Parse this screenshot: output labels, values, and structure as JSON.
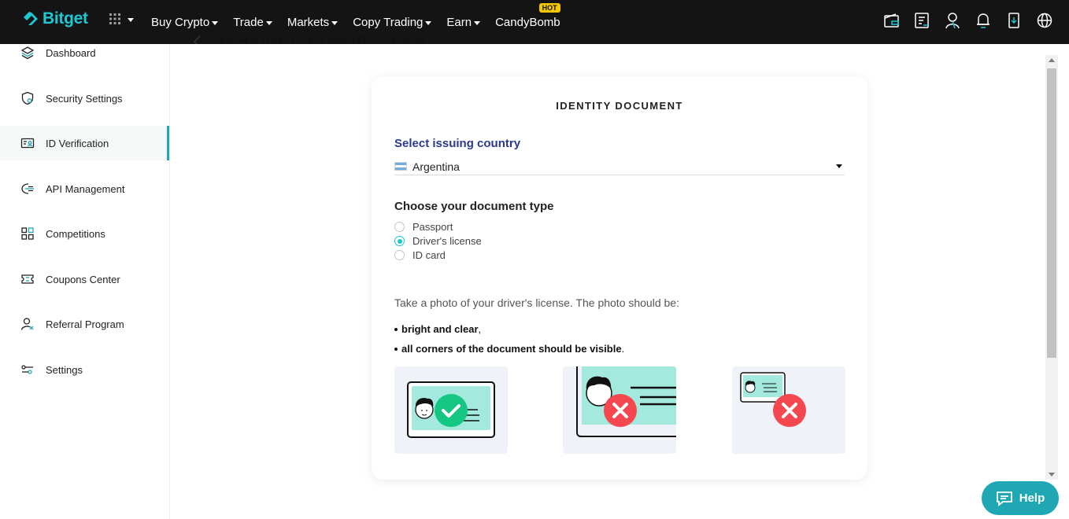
{
  "nav": {
    "logo": "Bitget",
    "menu": [
      {
        "label": "Buy Crypto",
        "has_caret": true
      },
      {
        "label": "Trade",
        "has_caret": true
      },
      {
        "label": "Markets",
        "has_caret": true
      },
      {
        "label": "Copy Trading",
        "has_caret": true
      },
      {
        "label": "Earn",
        "has_caret": true
      },
      {
        "label": "CandyBomb",
        "has_caret": false
      }
    ],
    "hot_badge": "HOT",
    "right_icons": [
      "wallet-icon",
      "orders-icon",
      "user-icon",
      "bell-icon",
      "download-icon",
      "globe-icon"
    ]
  },
  "sidebar": {
    "items": [
      {
        "label": "Dashboard",
        "icon": "layers-icon"
      },
      {
        "label": "Security Settings",
        "icon": "shield-icon"
      },
      {
        "label": "ID Verification",
        "icon": "id-card-icon",
        "active": true
      },
      {
        "label": "API Management",
        "icon": "api-icon"
      },
      {
        "label": "Competitions",
        "icon": "grid-icon"
      },
      {
        "label": "Coupons Center",
        "icon": "ticket-icon"
      },
      {
        "label": "Referral Program",
        "icon": "referral-icon"
      },
      {
        "label": "Settings",
        "icon": "sliders-icon"
      }
    ]
  },
  "main": {
    "title": "Individual Verification"
  },
  "card": {
    "heading": "IDENTITY DOCUMENT",
    "country_label": "Select issuing country",
    "country_value": "Argentina",
    "doc_type_label": "Choose your document type",
    "doc_types": [
      {
        "label": "Passport",
        "checked": false
      },
      {
        "label": "Driver's license",
        "checked": true
      },
      {
        "label": "ID card",
        "checked": false
      }
    ],
    "instructions": "Take a photo of your driver's license. The photo should be:",
    "bullets": [
      {
        "bold": "bright and clear",
        "rest": ","
      },
      {
        "bold": "all corners of the document should be visible",
        "rest": "."
      }
    ]
  },
  "help": {
    "label": "Help"
  },
  "colors": {
    "accent": "#1fc7d4",
    "nav_bg": "#141414",
    "link_blue": "#2b3a8c",
    "ok_green": "#16c784",
    "error_red": "#f5474f"
  }
}
